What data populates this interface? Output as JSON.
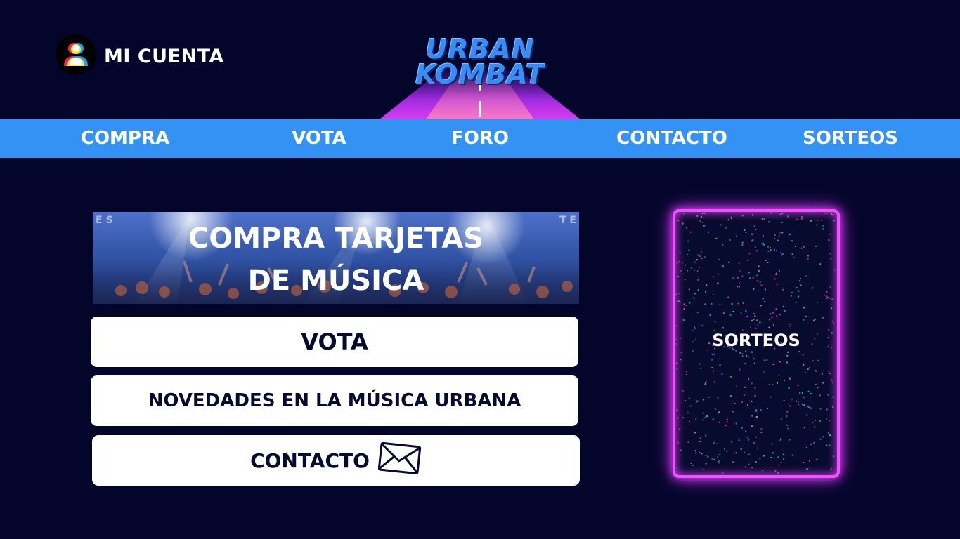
{
  "account": {
    "label": "MI CUENTA",
    "icon": "user-icon"
  },
  "logo": {
    "line1": "URBAN",
    "line2": "KOMBAT"
  },
  "nav": {
    "items": [
      {
        "label": "COMPRA"
      },
      {
        "label": "VOTA"
      },
      {
        "label": "FORO"
      },
      {
        "label": "CONTACTO"
      },
      {
        "label": "SORTEOS"
      }
    ]
  },
  "main": {
    "banner": {
      "line1": "COMPRA TARJETAS",
      "line2": "DE MÚSICA"
    },
    "vote_button": "VOTA",
    "news_button": "NOVEDADES EN LA MÚSICA URBANA",
    "contact_button": "CONTACTO",
    "contact_icon": "envelope-icon"
  },
  "sorteos_card": {
    "label": "SORTEOS"
  },
  "colors": {
    "background": "#03062a",
    "nav": "#3592f5",
    "neon": "#f052ff",
    "button_text": "#050a30"
  }
}
